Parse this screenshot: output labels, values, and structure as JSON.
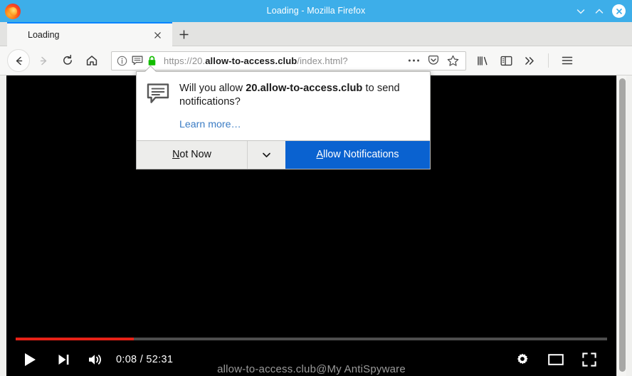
{
  "window": {
    "title": "Loading - Mozilla Firefox",
    "logo_icon": "firefox-logo",
    "minimize_icon": "chevron-down-icon",
    "maximize_icon": "chevron-up-icon",
    "close_icon": "close-icon",
    "titlebar_color": "#3daee9"
  },
  "tabs": {
    "active": {
      "label": "Loading",
      "close_icon": "close-icon",
      "indicator_color": "#0a84ff"
    },
    "new_tab_icon": "plus-icon"
  },
  "navigation": {
    "back_icon": "arrow-left-icon",
    "forward_icon": "arrow-right-icon",
    "reload_icon": "reload-icon",
    "home_icon": "home-icon",
    "library_icon": "library-icon",
    "sidebar_icon": "sidebar-icon",
    "overflow_icon": "chevron-double-right-icon",
    "menu_icon": "hamburger-menu-icon"
  },
  "urlbar": {
    "identity_icon": "info-circle-icon",
    "notification_permission_icon": "speech-bubble-icon",
    "lock_icon": "padlock-icon",
    "lock_color": "#12bc00",
    "scheme": "https://20.",
    "domain": "allow-to-access.club",
    "path": "/index.html?",
    "full_url": "https://20.allow-to-access.club/index.html?",
    "page_actions_icon": "ellipsis-icon",
    "pocket_icon": "pocket-icon",
    "bookmark_icon": "star-icon"
  },
  "doorhanger": {
    "icon": "speech-bubble-icon",
    "message_prefix": "Will you allow ",
    "message_domain": "20.allow-to-access.club",
    "message_suffix": " to send notifications?",
    "learn_more": "Learn more…",
    "not_now_accesskey": "N",
    "not_now_rest": "ot Now",
    "dropdown_icon": "chevron-down-icon",
    "allow_accesskey": "A",
    "allow_rest": "llow Notifications",
    "allow_color": "#0a62d0"
  },
  "player": {
    "play_icon": "play-icon",
    "next_icon": "next-track-icon",
    "volume_icon": "volume-icon",
    "current_time": "0:08",
    "separator": " / ",
    "duration": "52:31",
    "time_display": "0:08 / 52:31",
    "settings_icon": "gear-icon",
    "theater_icon": "theater-mode-icon",
    "fullscreen_icon": "fullscreen-icon",
    "progress_percent": 20,
    "progress_color": "#e62117",
    "watermark": "allow-to-access.club@My AntiSpyware"
  }
}
